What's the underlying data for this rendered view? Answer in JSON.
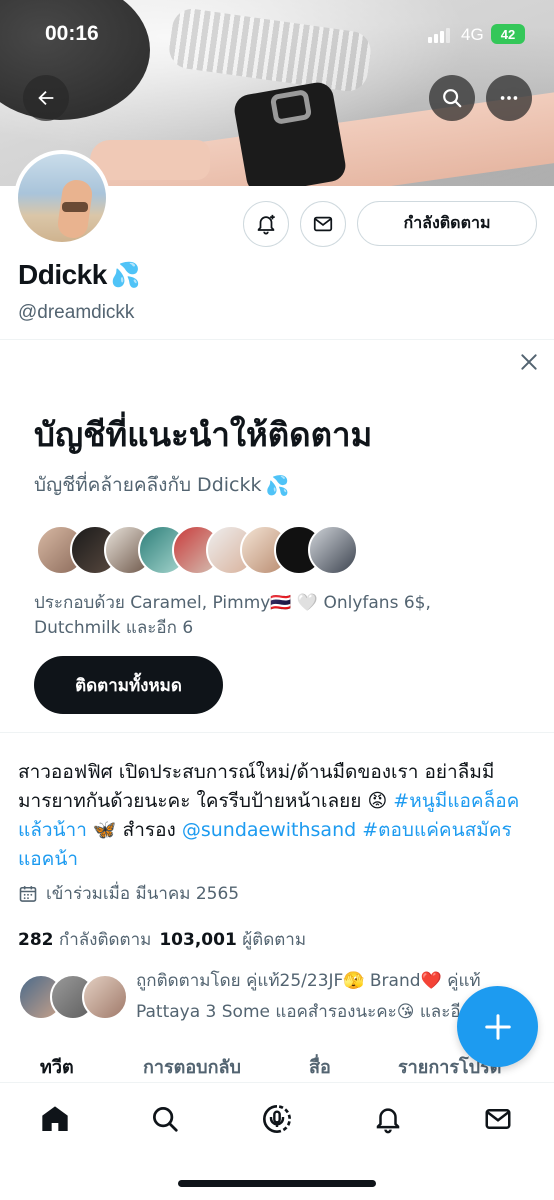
{
  "status_bar": {
    "time": "00:16",
    "network": "4G",
    "battery": "42"
  },
  "profile": {
    "display_name": "Ddickk",
    "name_emoji": "💦",
    "handle": "@dreamdickk",
    "following_button": "กำลังติดตาม"
  },
  "suggestions": {
    "title": "บัญชีที่แนะนำให้ติดตาม",
    "subtitle_prefix": "บัญชีที่คล้ายคลึงกับ Ddickk",
    "subtitle_emoji": "💦",
    "description_line1": "ประกอบด้วย Caramel, Pimmy🇹🇭 🤍 Onlyfans 6$,",
    "description_line2": "Dutchmilk และอีก 6",
    "follow_all_button": "ติดตามทั้งหมด"
  },
  "bio": {
    "text1": "สาวออฟฟิศ เปิดประสบการณ์ใหม่/ด้านมืดของเรา อย่าลืมมีมารยาทกันด้วยนะคะ ใครรีบป้ายหน้าเลยย 😡 ",
    "hashtag1": "#หนูมีแอคล็อคแล้วน้าา 🦋",
    "text2": " สำรอง ",
    "mention": "@sundaewithsand",
    "text3": " ",
    "hashtag2": "#ตอบแค่คนสมัครแอคน้า"
  },
  "joined": "เข้าร่วมเมื่อ มีนาคม 2565",
  "counts": {
    "following_num": "282",
    "following_label": "กำลังติดตาม",
    "followers_num": "103,001",
    "followers_label": "ผู้ติดตาม"
  },
  "followed_by": {
    "line1": "ถูกติดตามโดย คู่แท้25/23JF🫣 Brand❤️ คู่แท้",
    "line2": "Pattaya 3 Some แอคสำรองนะคะ😘 และอีก"
  },
  "tabs": [
    "ทวีต",
    "การตอบกลับ",
    "สื่อ",
    "รายการโปรด"
  ],
  "colors": {
    "accent": "#1d9bf0",
    "text": "#0f1419",
    "muted": "#536471",
    "border": "#cfd9de"
  },
  "icons": {
    "back": "arrow-left-icon",
    "search": "search-icon",
    "more": "more-icon",
    "notify": "bell-plus-icon",
    "message": "envelope-icon",
    "close": "close-icon",
    "calendar": "calendar-icon",
    "compose": "plus-icon",
    "nav": [
      "home-icon",
      "search-icon",
      "spaces-icon",
      "bell-icon",
      "envelope-icon"
    ]
  }
}
